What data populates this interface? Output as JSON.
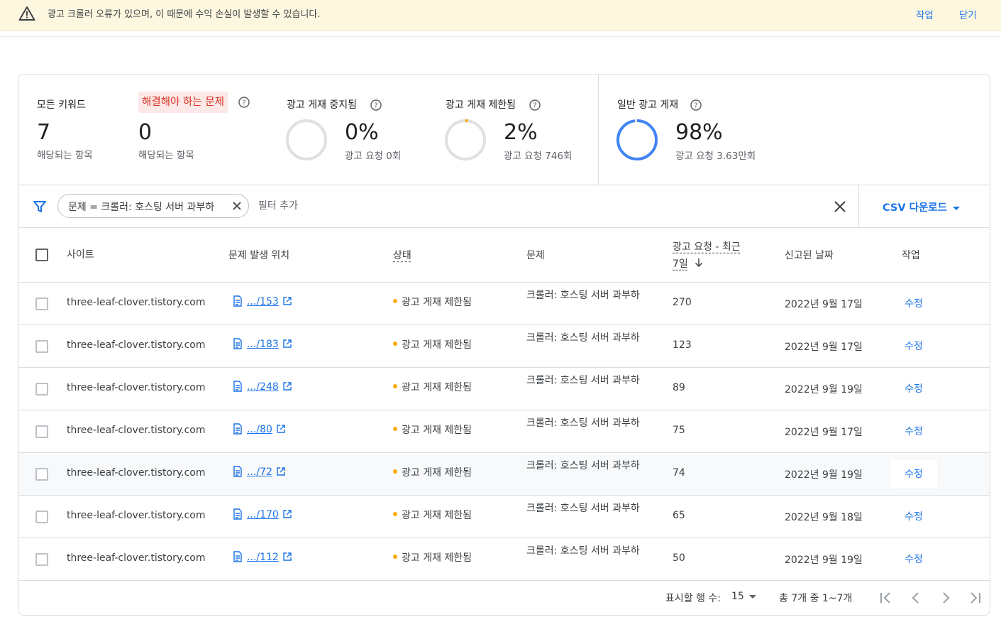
{
  "banner": {
    "message": "광고 크롤러 오류가 있으며, 이 때문에 수익 손실이 발생할 수 있습니다.",
    "action_label": "작업",
    "close_label": "닫기"
  },
  "stats": {
    "all_keywords": {
      "label": "모든 키워드",
      "value": "7",
      "sub": "해당되는 항목"
    },
    "issues": {
      "label": "해결해야 하는 문제",
      "value": "0",
      "sub": "해당되는 항목"
    },
    "stopped": {
      "label": "광고 게재 중지됨",
      "value": "0%",
      "sub": "광고 요청 0회",
      "fraction": 0.0
    },
    "limited": {
      "label": "광고 게재 제한됨",
      "value": "2%",
      "sub": "광고 요청 746회",
      "fraction": 0.02
    },
    "normal": {
      "label": "일반 광고 게재",
      "value": "98%",
      "sub": "광고 요청 3.63만회",
      "fraction": 0.98
    }
  },
  "filter": {
    "chip_label": "문제 = 크롤러: 호스팅 서버 과부하",
    "add_label": "필터 추가",
    "csv_label": "CSV 다운로드"
  },
  "table": {
    "headers": {
      "site": "사이트",
      "location": "문제 발생 위치",
      "status": "상태",
      "problem": "문제",
      "requests_line1": "광고 요청 - 최근",
      "requests_line2": "7일",
      "reported": "신고된 날짜",
      "action": "작업"
    },
    "rows": [
      {
        "site": "three-leaf-clover.tistory.com",
        "location": ".../153",
        "status": "광고 게재 제한됨",
        "problem": "크롤러: 호스팅 서버 과부하",
        "requests": "270",
        "date": "2022년 9월 17일",
        "action": "수정"
      },
      {
        "site": "three-leaf-clover.tistory.com",
        "location": ".../183",
        "status": "광고 게재 제한됨",
        "problem": "크롤러: 호스팅 서버 과부하",
        "requests": "123",
        "date": "2022년 9월 17일",
        "action": "수정"
      },
      {
        "site": "three-leaf-clover.tistory.com",
        "location": ".../248",
        "status": "광고 게재 제한됨",
        "problem": "크롤러: 호스팅 서버 과부하",
        "requests": "89",
        "date": "2022년 9월 19일",
        "action": "수정"
      },
      {
        "site": "three-leaf-clover.tistory.com",
        "location": ".../80",
        "status": "광고 게재 제한됨",
        "problem": "크롤러: 호스팅 서버 과부하",
        "requests": "75",
        "date": "2022년 9월 17일",
        "action": "수정"
      },
      {
        "site": "three-leaf-clover.tistory.com",
        "location": ".../72",
        "status": "광고 게재 제한됨",
        "problem": "크롤러: 호스팅 서버 과부하",
        "requests": "74",
        "date": "2022년 9월 19일",
        "action": "수정"
      },
      {
        "site": "three-leaf-clover.tistory.com",
        "location": ".../170",
        "status": "광고 게재 제한됨",
        "problem": "크롤러: 호스팅 서버 과부하",
        "requests": "65",
        "date": "2022년 9월 18일",
        "action": "수정"
      },
      {
        "site": "three-leaf-clover.tistory.com",
        "location": ".../112",
        "status": "광고 게재 제한됨",
        "problem": "크롤러: 호스팅 서버 과부하",
        "requests": "50",
        "date": "2022년 9월 19일",
        "action": "수정"
      }
    ]
  },
  "pagination": {
    "rows_label": "표시할 행 수:",
    "rows_value": "15",
    "range": "총 7개 중 1~7개"
  },
  "colors": {
    "accent": "#1a73e8",
    "warning": "#f9ab00",
    "issue_bg": "#fce8e6",
    "issue_text": "#d93025",
    "banner_bg": "#fef7e0"
  },
  "icons": [
    "warning-icon",
    "help-icon",
    "filter-icon",
    "close-icon",
    "document-icon",
    "open-in-new-icon",
    "arrow-down-icon",
    "first-page-icon",
    "chevron-left-icon",
    "chevron-right-icon",
    "last-page-icon"
  ]
}
